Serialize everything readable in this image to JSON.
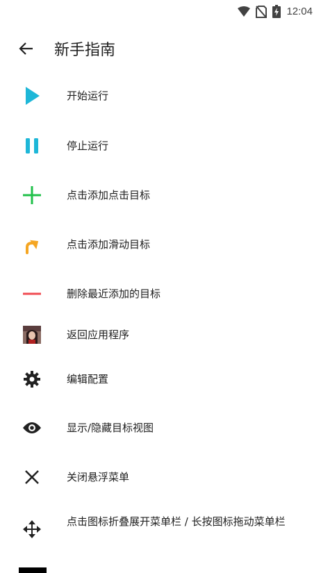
{
  "status_bar": {
    "time": "12:04",
    "icons": [
      "wifi-icon",
      "no-sim-icon",
      "battery-charging-icon"
    ]
  },
  "app_bar": {
    "back_icon": "arrow-left-icon",
    "title": "新手指南"
  },
  "items": [
    {
      "icon": "play-icon",
      "color": "#1EB7D8",
      "label": "开始运行"
    },
    {
      "icon": "pause-icon",
      "color": "#1EB7D8",
      "label": "停止运行"
    },
    {
      "icon": "plus-icon",
      "color": "#20C04A",
      "label": "点击添加点击目标"
    },
    {
      "icon": "curved-arrow-icon",
      "color": "#F5A623",
      "label": "点击添加滑动目标"
    },
    {
      "icon": "minus-icon",
      "color": "#F04B52",
      "label": "删除最近添加的目标"
    },
    {
      "icon": "app-avatar-icon",
      "color": "#6a3a3a",
      "label": "返回应用程序"
    },
    {
      "icon": "gear-icon",
      "color": "#212121",
      "label": "编辑配置"
    },
    {
      "icon": "eye-icon",
      "color": "#212121",
      "label": "显示/隐藏目标视图"
    },
    {
      "icon": "close-icon",
      "color": "#212121",
      "label": "关闭悬浮菜单"
    },
    {
      "icon": "move-icon",
      "color": "#212121",
      "label": "点击图标折叠展开菜单栏 / 长按图标拖动菜单栏"
    }
  ]
}
